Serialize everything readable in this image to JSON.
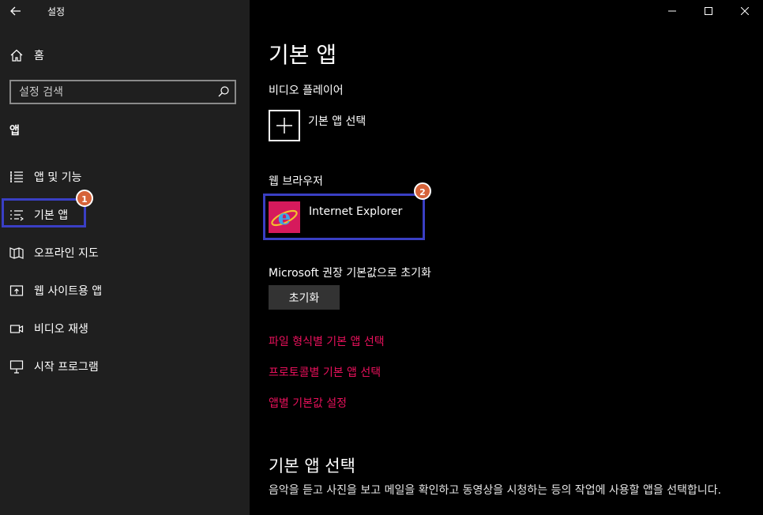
{
  "window": {
    "title": "설정",
    "back_icon": "back-arrow-icon",
    "controls": [
      "minimize",
      "maximize",
      "close"
    ]
  },
  "sidebar": {
    "home_label": "홈",
    "search_placeholder": "설정 검색",
    "section_label": "앱",
    "items": [
      {
        "label": "앱 및 기능",
        "icon": "apps-list-icon"
      },
      {
        "label": "기본 앱",
        "icon": "default-apps-icon",
        "selected": true
      },
      {
        "label": "오프라인 지도",
        "icon": "map-icon"
      },
      {
        "label": "웹 사이트용 앱",
        "icon": "website-app-icon"
      },
      {
        "label": "비디오 재생",
        "icon": "video-icon"
      },
      {
        "label": "시작 프로그램",
        "icon": "startup-icon"
      }
    ]
  },
  "annotations": {
    "badge1": "1",
    "badge2": "2",
    "highlight_color": "#3a3fc4",
    "badge_color": "#d6633a"
  },
  "main": {
    "page_title": "기본 앱",
    "video_player": {
      "heading": "비디오 플레이어",
      "choose_label": "기본 앱 선택"
    },
    "web_browser": {
      "heading": "웹 브라우저",
      "app_name": "Internet Explorer"
    },
    "reset": {
      "heading": "Microsoft 권장 기본값으로 초기화",
      "button_label": "초기화"
    },
    "links": {
      "by_file_type": "파일 형식별 기본 앱 선택",
      "by_protocol": "프로토콜별 기본 앱 선택",
      "by_app": "앱별 기본값 설정"
    },
    "link_color": "#e8115b",
    "choose_section": {
      "heading": "기본 앱 선택",
      "description": "음악을 듣고 사진을 보고 메일을 확인하고 동영상을 시청하는 등의 작업에 사용할 앱을 선택합니다."
    }
  }
}
